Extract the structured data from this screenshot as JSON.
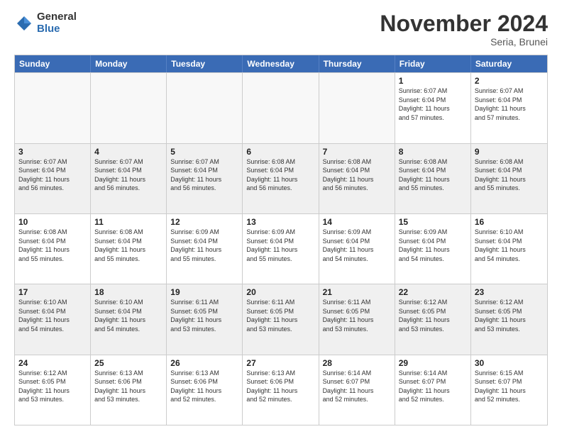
{
  "logo": {
    "general": "General",
    "blue": "Blue"
  },
  "header": {
    "month": "November 2024",
    "location": "Seria, Brunei"
  },
  "weekdays": [
    "Sunday",
    "Monday",
    "Tuesday",
    "Wednesday",
    "Thursday",
    "Friday",
    "Saturday"
  ],
  "rows": [
    [
      {
        "day": "",
        "info": ""
      },
      {
        "day": "",
        "info": ""
      },
      {
        "day": "",
        "info": ""
      },
      {
        "day": "",
        "info": ""
      },
      {
        "day": "",
        "info": ""
      },
      {
        "day": "1",
        "info": "Sunrise: 6:07 AM\nSunset: 6:04 PM\nDaylight: 11 hours\nand 57 minutes."
      },
      {
        "day": "2",
        "info": "Sunrise: 6:07 AM\nSunset: 6:04 PM\nDaylight: 11 hours\nand 57 minutes."
      }
    ],
    [
      {
        "day": "3",
        "info": "Sunrise: 6:07 AM\nSunset: 6:04 PM\nDaylight: 11 hours\nand 56 minutes."
      },
      {
        "day": "4",
        "info": "Sunrise: 6:07 AM\nSunset: 6:04 PM\nDaylight: 11 hours\nand 56 minutes."
      },
      {
        "day": "5",
        "info": "Sunrise: 6:07 AM\nSunset: 6:04 PM\nDaylight: 11 hours\nand 56 minutes."
      },
      {
        "day": "6",
        "info": "Sunrise: 6:08 AM\nSunset: 6:04 PM\nDaylight: 11 hours\nand 56 minutes."
      },
      {
        "day": "7",
        "info": "Sunrise: 6:08 AM\nSunset: 6:04 PM\nDaylight: 11 hours\nand 56 minutes."
      },
      {
        "day": "8",
        "info": "Sunrise: 6:08 AM\nSunset: 6:04 PM\nDaylight: 11 hours\nand 55 minutes."
      },
      {
        "day": "9",
        "info": "Sunrise: 6:08 AM\nSunset: 6:04 PM\nDaylight: 11 hours\nand 55 minutes."
      }
    ],
    [
      {
        "day": "10",
        "info": "Sunrise: 6:08 AM\nSunset: 6:04 PM\nDaylight: 11 hours\nand 55 minutes."
      },
      {
        "day": "11",
        "info": "Sunrise: 6:08 AM\nSunset: 6:04 PM\nDaylight: 11 hours\nand 55 minutes."
      },
      {
        "day": "12",
        "info": "Sunrise: 6:09 AM\nSunset: 6:04 PM\nDaylight: 11 hours\nand 55 minutes."
      },
      {
        "day": "13",
        "info": "Sunrise: 6:09 AM\nSunset: 6:04 PM\nDaylight: 11 hours\nand 55 minutes."
      },
      {
        "day": "14",
        "info": "Sunrise: 6:09 AM\nSunset: 6:04 PM\nDaylight: 11 hours\nand 54 minutes."
      },
      {
        "day": "15",
        "info": "Sunrise: 6:09 AM\nSunset: 6:04 PM\nDaylight: 11 hours\nand 54 minutes."
      },
      {
        "day": "16",
        "info": "Sunrise: 6:10 AM\nSunset: 6:04 PM\nDaylight: 11 hours\nand 54 minutes."
      }
    ],
    [
      {
        "day": "17",
        "info": "Sunrise: 6:10 AM\nSunset: 6:04 PM\nDaylight: 11 hours\nand 54 minutes."
      },
      {
        "day": "18",
        "info": "Sunrise: 6:10 AM\nSunset: 6:04 PM\nDaylight: 11 hours\nand 54 minutes."
      },
      {
        "day": "19",
        "info": "Sunrise: 6:11 AM\nSunset: 6:05 PM\nDaylight: 11 hours\nand 53 minutes."
      },
      {
        "day": "20",
        "info": "Sunrise: 6:11 AM\nSunset: 6:05 PM\nDaylight: 11 hours\nand 53 minutes."
      },
      {
        "day": "21",
        "info": "Sunrise: 6:11 AM\nSunset: 6:05 PM\nDaylight: 11 hours\nand 53 minutes."
      },
      {
        "day": "22",
        "info": "Sunrise: 6:12 AM\nSunset: 6:05 PM\nDaylight: 11 hours\nand 53 minutes."
      },
      {
        "day": "23",
        "info": "Sunrise: 6:12 AM\nSunset: 6:05 PM\nDaylight: 11 hours\nand 53 minutes."
      }
    ],
    [
      {
        "day": "24",
        "info": "Sunrise: 6:12 AM\nSunset: 6:05 PM\nDaylight: 11 hours\nand 53 minutes."
      },
      {
        "day": "25",
        "info": "Sunrise: 6:13 AM\nSunset: 6:06 PM\nDaylight: 11 hours\nand 53 minutes."
      },
      {
        "day": "26",
        "info": "Sunrise: 6:13 AM\nSunset: 6:06 PM\nDaylight: 11 hours\nand 52 minutes."
      },
      {
        "day": "27",
        "info": "Sunrise: 6:13 AM\nSunset: 6:06 PM\nDaylight: 11 hours\nand 52 minutes."
      },
      {
        "day": "28",
        "info": "Sunrise: 6:14 AM\nSunset: 6:07 PM\nDaylight: 11 hours\nand 52 minutes."
      },
      {
        "day": "29",
        "info": "Sunrise: 6:14 AM\nSunset: 6:07 PM\nDaylight: 11 hours\nand 52 minutes."
      },
      {
        "day": "30",
        "info": "Sunrise: 6:15 AM\nSunset: 6:07 PM\nDaylight: 11 hours\nand 52 minutes."
      }
    ]
  ]
}
